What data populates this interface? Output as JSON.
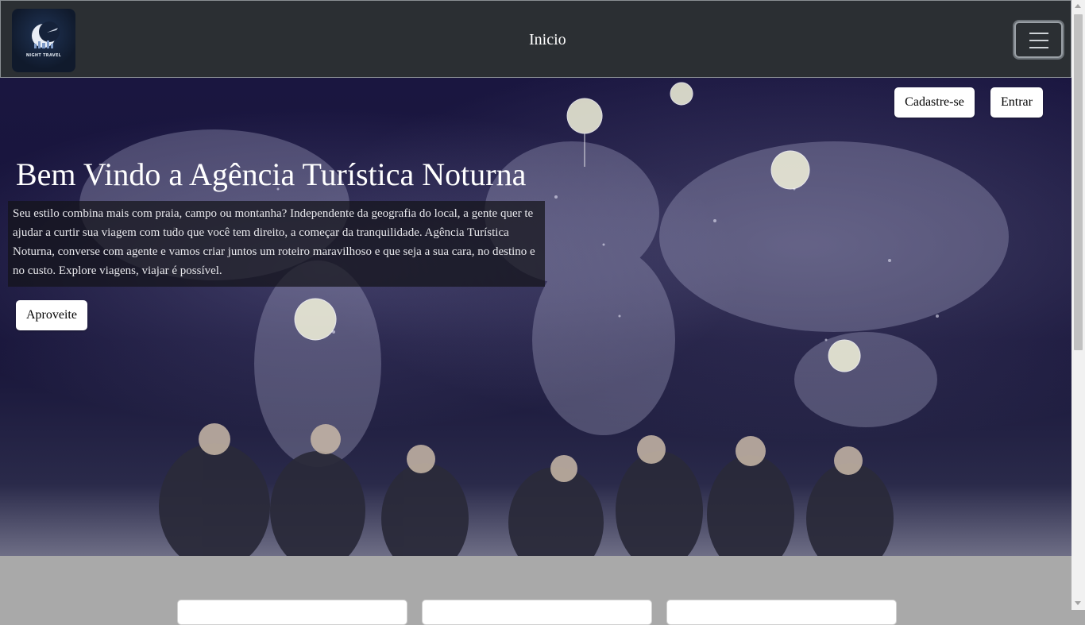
{
  "navbar": {
    "logo_text": "NIGHT TRAVEL",
    "link_label": "Inicio",
    "toggler_icon": "hamburger-menu-icon",
    "background": "#2b2f33"
  },
  "hero": {
    "signup_label": "Cadastre-se",
    "login_label": "Entrar",
    "title": "Bem Vindo a Agência Turística Noturna",
    "description": "Seu estilo combina mais com praia, campo ou montanha? Independente da geografia do local, a gente quer te ajudar a curtir sua viagem com tudo que você tem direito, a começar da tranquilidade. Agência Turística Noturna, converse com agente e vamos criar juntos um roteiro maravilhoso e que seja a sua cara, no destino e no custo. Explore viagens, viajar é possível.",
    "cta_label": "Aproveite"
  },
  "colors": {
    "section_bg": "#a9a9a9",
    "button_bg": "#ffffff"
  }
}
